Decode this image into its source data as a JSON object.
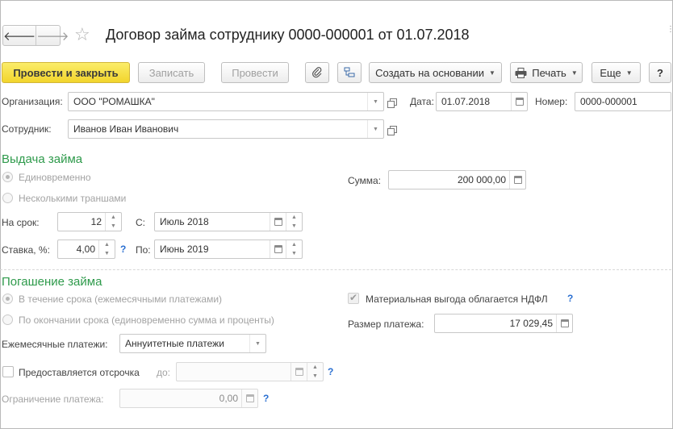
{
  "window": {
    "title": "Договор займа сотрудniku 0000-000001 от 01.07.2018"
  },
  "nav": {
    "back_symbol": "🡐",
    "forward_symbol": "🡒"
  },
  "toolbar": {
    "post_close": "Провести и закрыть",
    "write": "Записать",
    "post": "Провести",
    "create_based": "Создать на основании",
    "print": "Печать",
    "more": "Еще",
    "help": "?"
  },
  "header": {
    "org_label": "Организация:",
    "org_value": "ООО \"РОМАШКА\"",
    "date_label": "Дата:",
    "date_value": "01.07.2018",
    "number_label": "Номер:",
    "number_value": "0000-000001",
    "employee_label": "Сотрудник:",
    "employee_value": "Иванов Иван Иванович"
  },
  "issue": {
    "section_title": "Выдача займа",
    "radio_once": "Единовременно",
    "radio_tranches": "Несколькими траншами",
    "sum_label": "Сумма:",
    "sum_value": "200 000,00",
    "term_label": "На срок:",
    "term_value": "12",
    "from_label": "С:",
    "from_value": "Июль 2018",
    "rate_label": "Ставка, %:",
    "rate_value": "4,00",
    "to_label": "По:",
    "to_value": "Июнь 2019"
  },
  "repay": {
    "section_title": "Погашение займа",
    "radio_during": "В течение срока (ежемесячными платежами)",
    "radio_end": "По окончании срока (единовременно сумма и проценты)",
    "benefit_label": "Материальная выгода облагается НДФЛ",
    "payment_size_label": "Размер платежа:",
    "payment_size_value": "17 029,45",
    "monthly_label": "Ежемесячные платежи:",
    "monthly_value": "Аннуитетные платежи",
    "deferral_label": "Предоставляется отсрочка",
    "until_label": "до:",
    "limit_label": "Ограничение платежа:",
    "limit_value": "0,00"
  },
  "colors": {
    "accent_green": "#2e9a4b",
    "primary_yellow": "#f4d93a",
    "help_blue": "#2a6fd1"
  }
}
